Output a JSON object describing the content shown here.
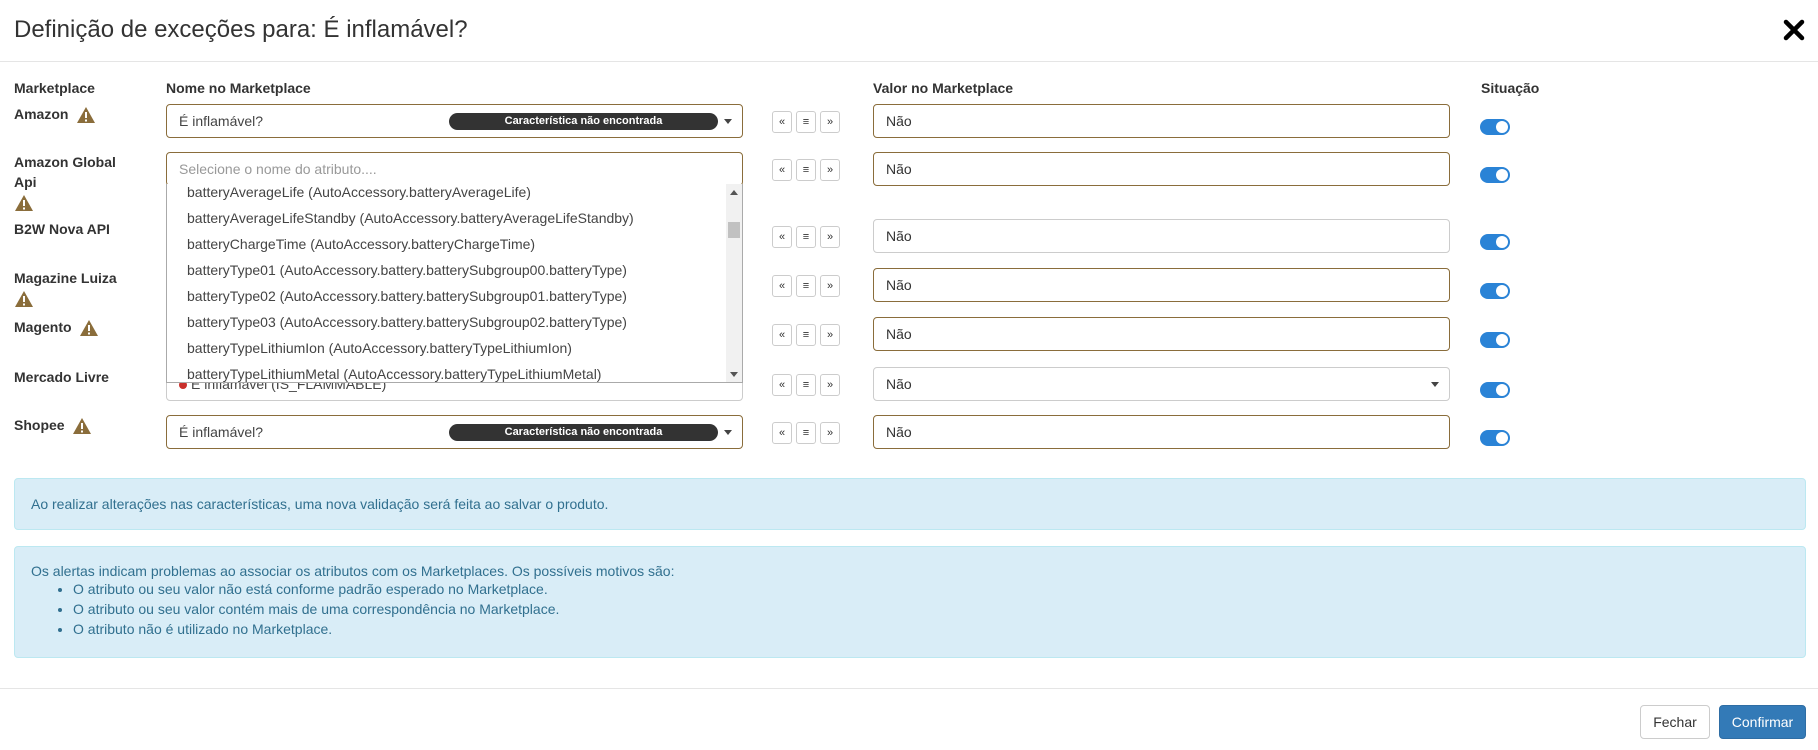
{
  "modal": {
    "title": "Definição de exceções para: É inflamável?",
    "close_icon": "close-icon"
  },
  "headers": {
    "marketplace": "Marketplace",
    "name_in_marketplace": "Nome no Marketplace",
    "value_in_marketplace": "Valor no Marketplace",
    "status": "Situação"
  },
  "rows": [
    {
      "marketplace": "Amazon",
      "warning": true,
      "attribute": "É inflamável?",
      "badge": "Característica não encontrada",
      "value": "Não",
      "toggle_on": true
    },
    {
      "marketplace": "Amazon Global Api",
      "warning": true,
      "attribute_placeholder": "Selecione o nome do atributo....",
      "value": "Não",
      "toggle_on": true
    },
    {
      "marketplace": "B2W Nova API",
      "warning": false,
      "value": "Não",
      "toggle_on": true
    },
    {
      "marketplace": "Magazine Luiza",
      "warning": true,
      "value": "Não",
      "toggle_on": true
    },
    {
      "marketplace": "Magento",
      "warning": true,
      "value": "Não",
      "toggle_on": true
    },
    {
      "marketplace": "Mercado Livre",
      "warning": false,
      "attribute": "É inflamável (IS_FLAMMABLE)",
      "value": "Não",
      "toggle_on": true
    },
    {
      "marketplace": "Shopee",
      "warning": true,
      "attribute": "É inflamável?",
      "badge": "Característica não encontrada",
      "value": "Não",
      "toggle_on": true
    }
  ],
  "dropdown_options": [
    "batteryAverageLife (AutoAccessory.batteryAverageLife)",
    "batteryAverageLifeStandby (AutoAccessory.batteryAverageLifeStandby)",
    "batteryChargeTime (AutoAccessory.batteryChargeTime)",
    "batteryType01 (AutoAccessory.battery.batterySubgroup00.batteryType)",
    "batteryType02 (AutoAccessory.battery.batterySubgroup01.batteryType)",
    "batteryType03 (AutoAccessory.battery.batterySubgroup02.batteryType)",
    "batteryTypeLithiumIon (AutoAccessory.batteryTypeLithiumIon)",
    "batteryTypeLithiumMetal (AutoAccessory.batteryTypeLithiumMetal)"
  ],
  "buttons": {
    "copy_left": "«",
    "center": "≡",
    "copy_right": "»"
  },
  "info_1": "Ao realizar alterações nas características, uma nova validação será feita ao salvar o produto.",
  "info_2": {
    "intro": "Os alertas indicam problemas ao associar os atributos com os Marketplaces. Os possíveis motivos são:",
    "items": [
      "O atributo ou seu valor não está conforme padrão esperado no Marketplace.",
      "O atributo ou seu valor contém mais de uma correspondência no Marketplace.",
      "O atributo não é utilizado no Marketplace."
    ]
  },
  "footer": {
    "close_label": "Fechar",
    "confirm_label": "Confirmar"
  },
  "colors": {
    "warning": "#8a6d3b",
    "toggle": "#2a83d6",
    "primary": "#337ab7",
    "info_bg": "#d9edf7",
    "info_text": "#31708f"
  }
}
